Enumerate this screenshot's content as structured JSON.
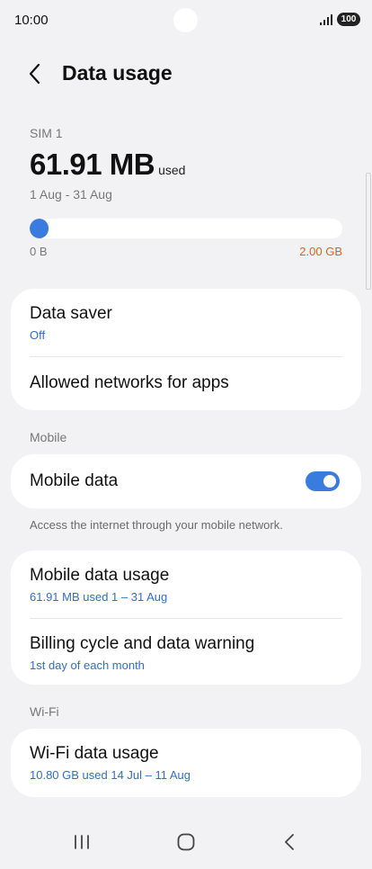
{
  "status_bar": {
    "time": "10:00",
    "battery": "100",
    "icons": [
      "signal-icon",
      "battery-icon"
    ]
  },
  "header": {
    "title": "Data usage",
    "back_icon": "chevron-left-icon"
  },
  "usage": {
    "sim_label": "SIM 1",
    "amount": "61.91 MB",
    "unit_label": "used",
    "period": "1 Aug - 31 Aug",
    "progress_fraction": 0.03,
    "progress_min_label": "0 B",
    "progress_max_label": "2.00 GB"
  },
  "card_saver": {
    "data_saver_label": "Data saver",
    "data_saver_status": "Off",
    "allowed_networks_label": "Allowed networks for apps"
  },
  "mobile_section": {
    "label": "Mobile",
    "mobile_data_label": "Mobile data",
    "mobile_data_enabled": true,
    "helper": "Access the internet through your mobile network."
  },
  "card_mobile_usage": {
    "mobile_data_usage_label": "Mobile data usage",
    "mobile_data_usage_sub": "61.91 MB used 1 – 31 Aug",
    "billing_label": "Billing cycle and data warning",
    "billing_sub": "1st day of each month"
  },
  "wifi_section": {
    "label": "Wi-Fi",
    "wifi_usage_label": "Wi-Fi data usage",
    "wifi_usage_sub": "10.80 GB used 14 Jul – 11 Aug"
  },
  "nav_bar": {
    "icons": [
      "recent-apps-icon",
      "home-icon",
      "back-icon"
    ]
  },
  "colors": {
    "accent": "#3a7be0",
    "link": "#2f6fc9",
    "warning": "#e0601f",
    "background": "#f2f2f4"
  }
}
